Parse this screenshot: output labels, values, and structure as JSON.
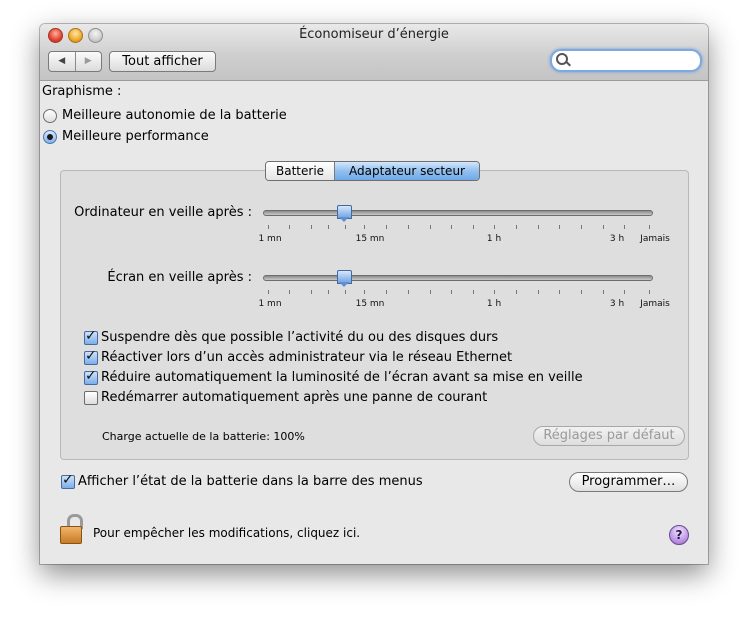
{
  "window": {
    "title": "Économiseur d’énergie"
  },
  "toolbar": {
    "back": "◀",
    "forward": "▶",
    "show_all": "Tout afficher",
    "search_placeholder": ""
  },
  "graphics": {
    "label": "Graphisme :",
    "options": [
      "Meilleure autonomie de la batterie",
      "Meilleure performance"
    ],
    "selected": "Meilleure performance"
  },
  "tabs": {
    "items": [
      "Batterie",
      "Adaptateur secteur"
    ],
    "selected": "Adaptateur secteur"
  },
  "sliders": {
    "computer": {
      "label": "Ordinateur en veille après :",
      "value": "15 mn"
    },
    "display": {
      "label": "Écran en veille après :",
      "value": "15 mn"
    },
    "ticks": {
      "min": "1 mn",
      "m15": "15 mn",
      "h1": "1 h",
      "h3": "3 h",
      "never": "Jamais"
    }
  },
  "checkboxes": [
    {
      "label": "Suspendre dès que possible l’activité du ou des disques durs",
      "checked": true
    },
    {
      "label": "Réactiver lors d’un accès administrateur via le réseau Ethernet",
      "checked": true
    },
    {
      "label": "Réduire automatiquement la luminosité de l’écran avant sa mise en veille",
      "checked": true
    },
    {
      "label": "Redémarrer automatiquement après une panne de courant",
      "checked": false
    }
  ],
  "battery": {
    "charge_text": "Charge actuelle de la batterie: 100%"
  },
  "buttons": {
    "defaults": "Réglages par défaut",
    "schedule": "Programmer…"
  },
  "menu_battery": {
    "label": "Afficher l’état de la batterie dans la barre des menus",
    "checked": true
  },
  "footer": {
    "lock_text": "Pour empêcher les modifications, cliquez ici.",
    "help": "?"
  }
}
